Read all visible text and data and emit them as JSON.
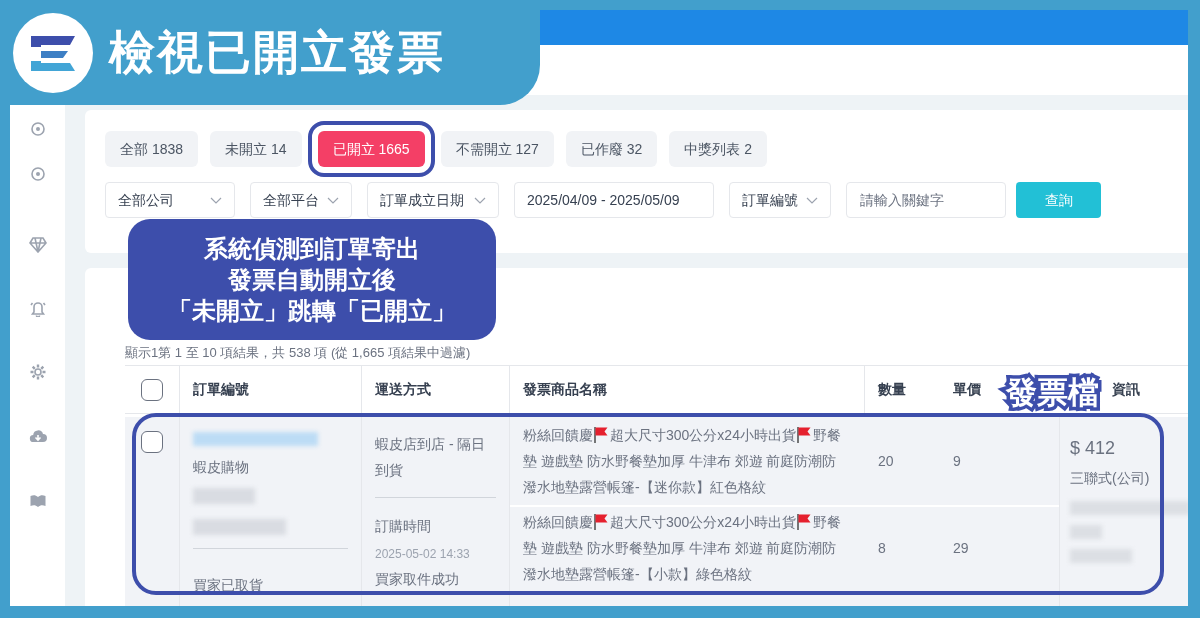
{
  "banner": {
    "title": "檢視已開立發票"
  },
  "tabs": [
    {
      "label": "全部 1838",
      "selected": false
    },
    {
      "label": "未開立 14",
      "selected": false
    },
    {
      "label": "已開立 1665",
      "selected": true
    },
    {
      "label": "不需開立 127",
      "selected": false
    },
    {
      "label": "已作廢 32",
      "selected": false
    },
    {
      "label": "中獎列表 2",
      "selected": false
    }
  ],
  "filters": [
    {
      "kind": "dropdown",
      "value": "全部公司"
    },
    {
      "kind": "dropdown",
      "value": "全部平台"
    },
    {
      "kind": "dropdown",
      "value": "訂單成立日期"
    },
    {
      "kind": "date",
      "value": "2025/04/09 - 2025/05/09"
    },
    {
      "kind": "dropdown",
      "value": "訂單編號"
    },
    {
      "kind": "search",
      "placeholder": "請輸入關鍵字"
    }
  ],
  "query_button": "查詢",
  "callout": {
    "lines": [
      "系統偵測到訂單寄出",
      "發票自動開立後",
      "「未開立」跳轉「已開立」"
    ]
  },
  "summary": "顯示1第 1 至 10 項結果，共 538 項 (從 1,665 項結果中過濾)",
  "table": {
    "header_checked": false,
    "columns": [
      "訂單編號",
      "運送方式",
      "發票商品名稱",
      "數量",
      "單價",
      "資訊"
    ],
    "rows": [
      {
        "checked": false,
        "platform": "蝦皮購物",
        "status": "買家已取貨",
        "shipping": "蝦皮店到店 - 隔日到貨",
        "order_time_label": "訂購時間",
        "order_time": "2025-05-02 14:33",
        "pickup_status": "買家取件成功",
        "amount": "$ 412",
        "invoice_type": "三聯式(公司)",
        "items": [
          {
            "name_lines": [
              [
                "粉絲回饋慶",
                "超大尺寸300公分x24小時出貨",
                "野餐"
              ],
              [
                "墊 遊戲墊 防水野餐墊加厚 牛津布 郊遊 前庭防潮防"
              ],
              [
                "潑水地墊露營帳篷-【迷你款】紅色格紋"
              ]
            ],
            "quantity": "20",
            "unit_price": "9"
          },
          {
            "name_lines": [
              [
                "粉絲回饋慶",
                "超大尺寸300公分x24小時出貨",
                "野餐"
              ],
              [
                "墊 遊戲墊 防水野餐墊加厚 牛津布 郊遊 前庭防潮防"
              ],
              [
                "潑水地墊露營帳篷-【小款】綠色格紋"
              ]
            ],
            "quantity": "8",
            "unit_price": "29"
          }
        ]
      }
    ]
  },
  "annotation": {
    "label": "發票檔"
  }
}
